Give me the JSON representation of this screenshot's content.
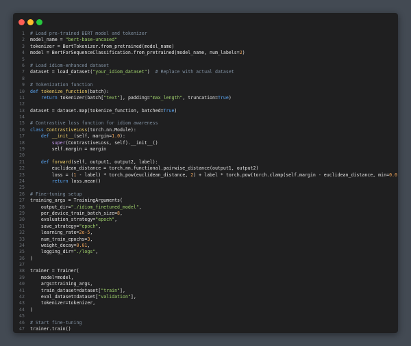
{
  "window": {
    "controls": [
      "close",
      "minimize",
      "maximize"
    ],
    "colors": {
      "close": "#ff5f56",
      "minimize": "#ffbd2e",
      "maximize": "#27c93f"
    }
  },
  "code": {
    "lines": [
      {
        "n": "1",
        "tokens": [
          {
            "t": "# Load pre-trained BERT model and tokenizer",
            "c": "cm"
          }
        ]
      },
      {
        "n": "2",
        "tokens": [
          {
            "t": "model_name = ",
            "c": "pl"
          },
          {
            "t": "\"bert-base-uncased\"",
            "c": "st"
          }
        ]
      },
      {
        "n": "3",
        "tokens": [
          {
            "t": "tokenizer = BertTokenizer.from_pretrained(model_name)",
            "c": "pl"
          }
        ]
      },
      {
        "n": "4",
        "tokens": [
          {
            "t": "model = BertForSequenceClassification.from_pretrained(model_name, num_labels=",
            "c": "pl"
          },
          {
            "t": "2",
            "c": "nm"
          },
          {
            "t": ")",
            "c": "pl"
          }
        ]
      },
      {
        "n": "5",
        "tokens": []
      },
      {
        "n": "6",
        "tokens": [
          {
            "t": "# Load idiom-enhanced dataset",
            "c": "cm"
          }
        ]
      },
      {
        "n": "7",
        "tokens": [
          {
            "t": "dataset = load_dataset(",
            "c": "pl"
          },
          {
            "t": "\"your_idiom_dataset\"",
            "c": "st"
          },
          {
            "t": ")  ",
            "c": "pl"
          },
          {
            "t": "# Replace with actual dataset",
            "c": "cm"
          }
        ]
      },
      {
        "n": "8",
        "tokens": []
      },
      {
        "n": "9",
        "tokens": [
          {
            "t": "# Tokenization function",
            "c": "cm"
          }
        ]
      },
      {
        "n": "10",
        "tokens": [
          {
            "t": "def ",
            "c": "kw"
          },
          {
            "t": "tokenize_function",
            "c": "fn"
          },
          {
            "t": "(batch):",
            "c": "pl"
          }
        ]
      },
      {
        "n": "11",
        "tokens": [
          {
            "t": "    ",
            "c": "pl"
          },
          {
            "t": "return ",
            "c": "kw"
          },
          {
            "t": "tokenizer(batch[",
            "c": "pl"
          },
          {
            "t": "\"text\"",
            "c": "st"
          },
          {
            "t": "], padding=",
            "c": "pl"
          },
          {
            "t": "\"max_length\"",
            "c": "st"
          },
          {
            "t": ", truncation=",
            "c": "pl"
          },
          {
            "t": "True",
            "c": "kw"
          },
          {
            "t": ")",
            "c": "pl"
          }
        ]
      },
      {
        "n": "12",
        "tokens": []
      },
      {
        "n": "13",
        "tokens": [
          {
            "t": "dataset = dataset.map(tokenize_function, batched=",
            "c": "pl"
          },
          {
            "t": "True",
            "c": "kw"
          },
          {
            "t": ")",
            "c": "pl"
          }
        ]
      },
      {
        "n": "14",
        "tokens": []
      },
      {
        "n": "15",
        "tokens": [
          {
            "t": "# Contrastive loss function for idiom awareness",
            "c": "cm"
          }
        ]
      },
      {
        "n": "16",
        "tokens": [
          {
            "t": "class ",
            "c": "kw"
          },
          {
            "t": "ContrastiveLoss",
            "c": "fn"
          },
          {
            "t": "(torch.nn.Module):",
            "c": "pl"
          }
        ]
      },
      {
        "n": "17",
        "tokens": [
          {
            "t": "    ",
            "c": "pl"
          },
          {
            "t": "def ",
            "c": "kw"
          },
          {
            "t": "__init__",
            "c": "fn"
          },
          {
            "t": "(self, margin=",
            "c": "pl"
          },
          {
            "t": "1.0",
            "c": "nm"
          },
          {
            "t": "):",
            "c": "pl"
          }
        ]
      },
      {
        "n": "18",
        "tokens": [
          {
            "t": "        ",
            "c": "pl"
          },
          {
            "t": "super",
            "c": "bi"
          },
          {
            "t": "(ContrastiveLoss, self).__init__()",
            "c": "pl"
          }
        ]
      },
      {
        "n": "19",
        "tokens": [
          {
            "t": "        self.margin = margin",
            "c": "pl"
          }
        ]
      },
      {
        "n": "20",
        "tokens": []
      },
      {
        "n": "21",
        "tokens": [
          {
            "t": "    ",
            "c": "pl"
          },
          {
            "t": "def ",
            "c": "kw"
          },
          {
            "t": "forward",
            "c": "fn"
          },
          {
            "t": "(self, output1, output2, label):",
            "c": "pl"
          }
        ]
      },
      {
        "n": "22",
        "tokens": [
          {
            "t": "        euclidean_distance = torch.nn.functional.pairwise_distance(output1, output2)",
            "c": "pl"
          }
        ]
      },
      {
        "n": "23",
        "tokens": [
          {
            "t": "        loss = (",
            "c": "pl"
          },
          {
            "t": "1",
            "c": "nm"
          },
          {
            "t": " - label) * torch.pow(euclidean_distance, ",
            "c": "pl"
          },
          {
            "t": "2",
            "c": "nm"
          },
          {
            "t": ") + label * torch.pow(torch.clamp(self.margin - euclidean_distance, min=",
            "c": "pl"
          },
          {
            "t": "0.0",
            "c": "nm"
          },
          {
            "t": "), ",
            "c": "pl"
          },
          {
            "t": "2",
            "c": "nm"
          },
          {
            "t": ")",
            "c": "pl"
          }
        ]
      },
      {
        "n": "24",
        "tokens": [
          {
            "t": "        ",
            "c": "pl"
          },
          {
            "t": "return ",
            "c": "kw"
          },
          {
            "t": "loss.mean()",
            "c": "pl"
          }
        ]
      },
      {
        "n": "25",
        "tokens": []
      },
      {
        "n": "26",
        "tokens": [
          {
            "t": "# Fine-tuning setup",
            "c": "cm"
          }
        ]
      },
      {
        "n": "27",
        "tokens": [
          {
            "t": "training_args = TrainingArguments(",
            "c": "pl"
          }
        ]
      },
      {
        "n": "28",
        "tokens": [
          {
            "t": "    output_dir=",
            "c": "pl"
          },
          {
            "t": "\"./idiom_finetuned_model\"",
            "c": "st"
          },
          {
            "t": ",",
            "c": "pl"
          }
        ]
      },
      {
        "n": "29",
        "tokens": [
          {
            "t": "    per_device_train_batch_size=",
            "c": "pl"
          },
          {
            "t": "8",
            "c": "nm"
          },
          {
            "t": ",",
            "c": "pl"
          }
        ]
      },
      {
        "n": "30",
        "tokens": [
          {
            "t": "    evaluation_strategy=",
            "c": "pl"
          },
          {
            "t": "\"epoch\"",
            "c": "st"
          },
          {
            "t": ",",
            "c": "pl"
          }
        ]
      },
      {
        "n": "31",
        "tokens": [
          {
            "t": "    save_strategy=",
            "c": "pl"
          },
          {
            "t": "\"epoch\"",
            "c": "st"
          },
          {
            "t": ",",
            "c": "pl"
          }
        ]
      },
      {
        "n": "32",
        "tokens": [
          {
            "t": "    learning_rate=",
            "c": "pl"
          },
          {
            "t": "2e-5",
            "c": "nm"
          },
          {
            "t": ",",
            "c": "pl"
          }
        ]
      },
      {
        "n": "33",
        "tokens": [
          {
            "t": "    num_train_epochs=",
            "c": "pl"
          },
          {
            "t": "3",
            "c": "nm"
          },
          {
            "t": ",",
            "c": "pl"
          }
        ]
      },
      {
        "n": "34",
        "tokens": [
          {
            "t": "    weight_decay=",
            "c": "pl"
          },
          {
            "t": "0.01",
            "c": "nm"
          },
          {
            "t": ",",
            "c": "pl"
          }
        ]
      },
      {
        "n": "35",
        "tokens": [
          {
            "t": "    logging_dir=",
            "c": "pl"
          },
          {
            "t": "\"./logs\"",
            "c": "st"
          },
          {
            "t": ",",
            "c": "pl"
          }
        ]
      },
      {
        "n": "36",
        "tokens": [
          {
            "t": ")",
            "c": "pl"
          }
        ]
      },
      {
        "n": "37",
        "tokens": []
      },
      {
        "n": "38",
        "tokens": [
          {
            "t": "trainer = Trainer(",
            "c": "pl"
          }
        ]
      },
      {
        "n": "39",
        "tokens": [
          {
            "t": "    model=model,",
            "c": "pl"
          }
        ]
      },
      {
        "n": "40",
        "tokens": [
          {
            "t": "    args=training_args,",
            "c": "pl"
          }
        ]
      },
      {
        "n": "41",
        "tokens": [
          {
            "t": "    train_dataset=dataset[",
            "c": "pl"
          },
          {
            "t": "\"train\"",
            "c": "st"
          },
          {
            "t": "],",
            "c": "pl"
          }
        ]
      },
      {
        "n": "42",
        "tokens": [
          {
            "t": "    eval_dataset=dataset[",
            "c": "pl"
          },
          {
            "t": "\"validation\"",
            "c": "st"
          },
          {
            "t": "],",
            "c": "pl"
          }
        ]
      },
      {
        "n": "43",
        "tokens": [
          {
            "t": "    tokenizer=tokenizer,",
            "c": "pl"
          }
        ]
      },
      {
        "n": "44",
        "tokens": [
          {
            "t": ")",
            "c": "pl"
          }
        ]
      },
      {
        "n": "45",
        "tokens": []
      },
      {
        "n": "46",
        "tokens": [
          {
            "t": "# Start fine-tuning",
            "c": "cm"
          }
        ]
      },
      {
        "n": "47",
        "tokens": [
          {
            "t": "trainer.train()",
            "c": "pl"
          }
        ]
      }
    ]
  }
}
